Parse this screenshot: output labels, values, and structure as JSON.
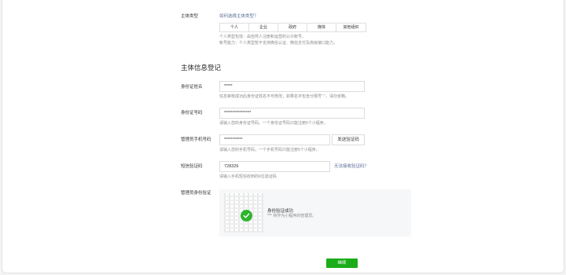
{
  "entity_type": {
    "label": "主体类型",
    "help_link": "如何选择主体类型？",
    "options": [
      "个人",
      "企业",
      "政府",
      "媒体",
      "其他组织"
    ],
    "tips": [
      "个人类型包括：由自然人注册和运营的公众帐号。",
      "帐号能力：个人类型暂不支持微信认证、微信支付及高级接口能力。"
    ]
  },
  "section_title": "主体信息登记",
  "id_name": {
    "label": "身份证姓名",
    "value": "*****",
    "tip": "信息审核成功后身份证姓名不可修改；如果名字包含分隔号“·”，请勿省略。"
  },
  "id_number": {
    "label": "身份证号码",
    "value": "****************",
    "tip": "请输入您的身份证号码。一个身份证号码只能注册5个小程序。"
  },
  "phone": {
    "label": "管理员手机号码",
    "value": "***********",
    "send_button": "发送验证码",
    "tip": "请输入您的手机号码，一个手机号码只能注册5个小程序。"
  },
  "sms_code": {
    "label": "短信验证码",
    "value": "728329",
    "help_link": "无法接收验证码？",
    "tip": "请输入手机短信收到的6位验证码"
  },
  "admin_verify": {
    "label": "管理员身份验证",
    "success_title": "身份验证成功",
    "success_desc": "*** 将作为小程序的管理员。"
  },
  "continue_button": "继续",
  "colors": {
    "primary": "#1aad19",
    "link": "#576b95",
    "tip": "#8a8a8a",
    "panel_bg": "#f6f7f9"
  }
}
